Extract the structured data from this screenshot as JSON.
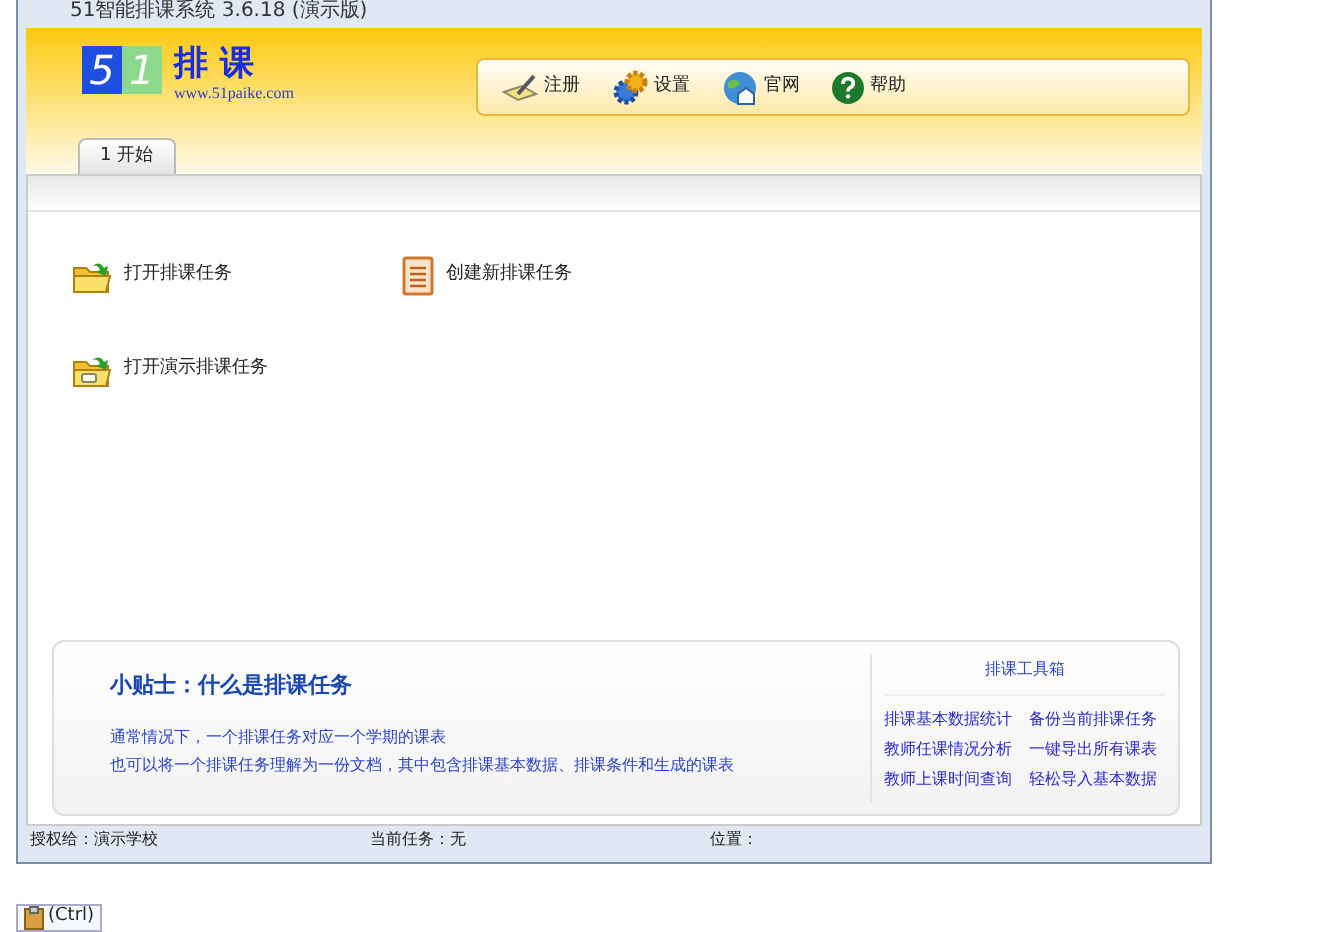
{
  "window": {
    "title": "51智能排课系统 3.6.18 (演示版)"
  },
  "logo": {
    "digits": [
      "5",
      "1"
    ],
    "name": "排 课",
    "url": "www.51paike.com"
  },
  "toolbar": [
    {
      "kind": "register",
      "label": "注册"
    },
    {
      "kind": "settings",
      "label": "设置"
    },
    {
      "kind": "website",
      "label": "官网"
    },
    {
      "kind": "help",
      "label": "帮助"
    }
  ],
  "tabs": [
    {
      "label": "1 开始",
      "selected": true
    }
  ],
  "actions": [
    {
      "kind": "open",
      "label": "打开排课任务"
    },
    {
      "kind": "new",
      "label": "创建新排课任务"
    },
    {
      "kind": "demo",
      "label": "打开演示排课任务"
    }
  ],
  "tip": {
    "title": "小贴士：什么是排课任务",
    "lines": [
      "通常情况下，一个排课任务对应一个学期的课表",
      "也可以将一个排课任务理解为一份文档，其中包含排课基本数据、排课条件和生成的课表"
    ]
  },
  "toolbox": {
    "title": "排课工具箱",
    "links": [
      "排课基本数据统计",
      "备份当前排课任务",
      "教师任课情况分析",
      "一键导出所有课表",
      "教师上课时间查询",
      "轻松导入基本数据"
    ]
  },
  "status_bar": [
    "授权给：演示学校",
    "当前任务：无",
    "位置："
  ],
  "paste_options": {
    "label": "(Ctrl)"
  }
}
